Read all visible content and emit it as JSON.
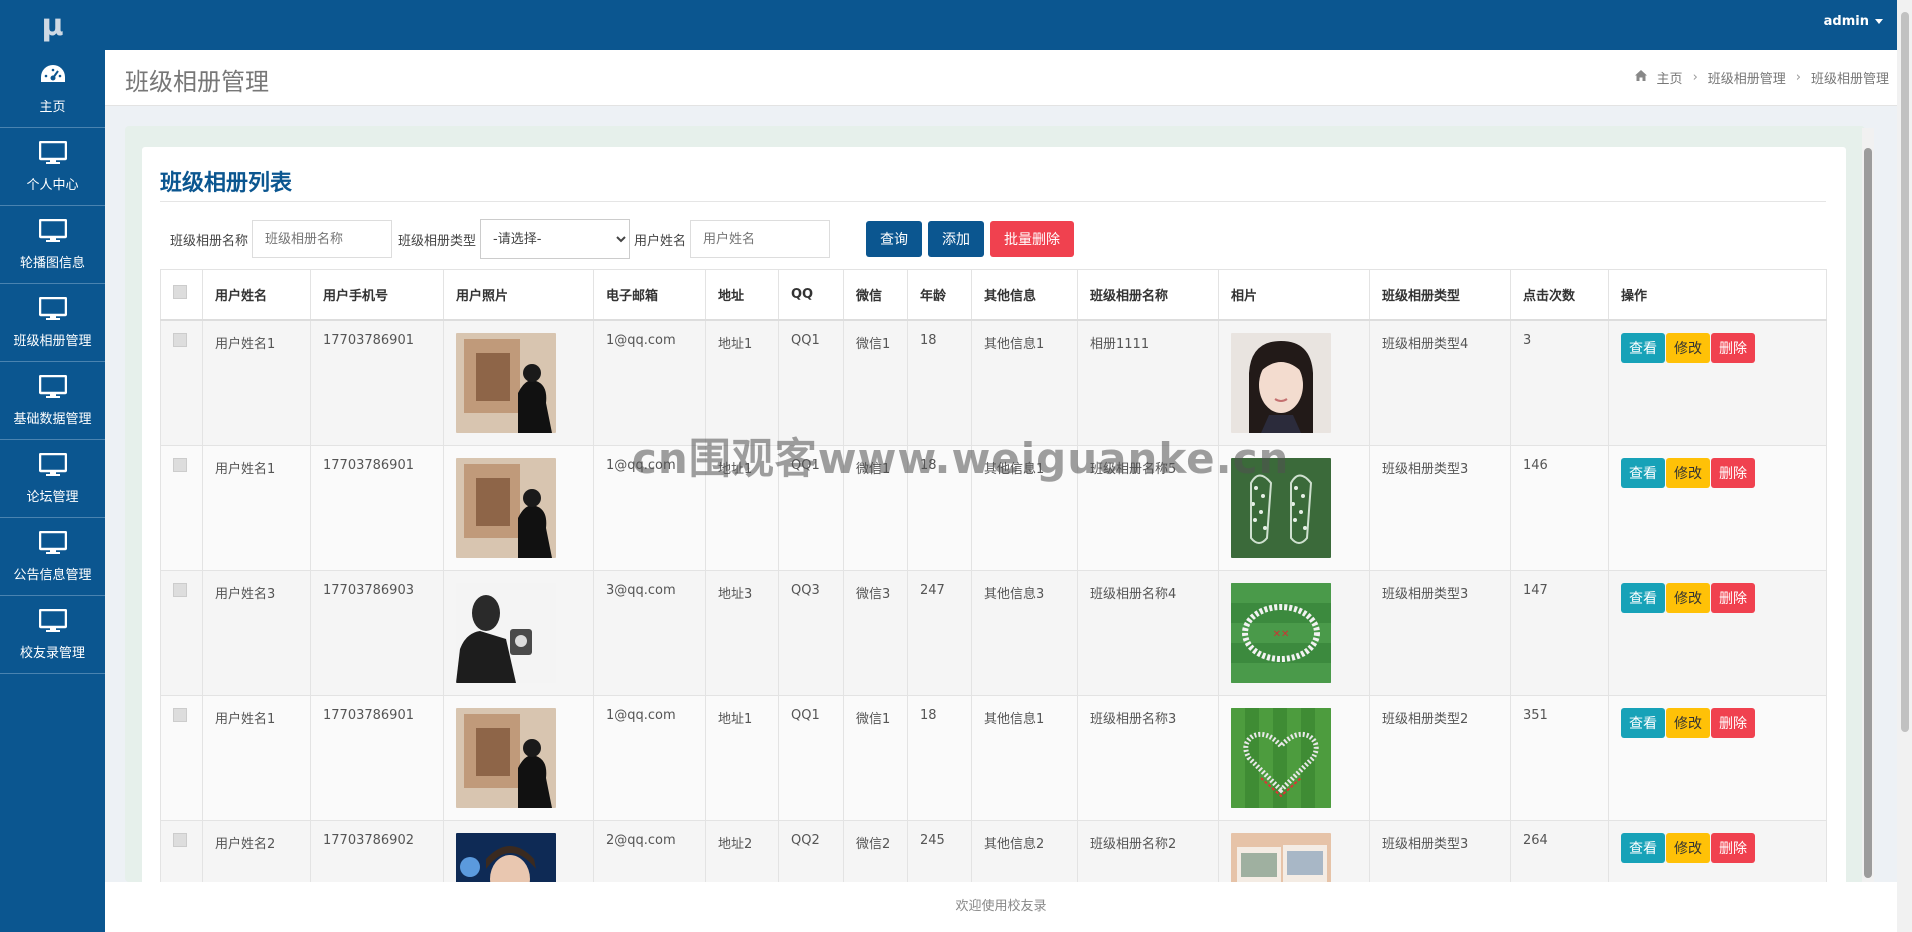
{
  "app": {
    "logo": "μ"
  },
  "sidebar": {
    "items": [
      {
        "label": "主页",
        "icon": "dashboard-icon"
      },
      {
        "label": "个人中心",
        "icon": "monitor-icon"
      },
      {
        "label": "轮播图信息",
        "icon": "monitor-icon"
      },
      {
        "label": "班级相册管理",
        "icon": "monitor-icon"
      },
      {
        "label": "基础数据管理",
        "icon": "monitor-icon"
      },
      {
        "label": "论坛管理",
        "icon": "monitor-icon"
      },
      {
        "label": "公告信息管理",
        "icon": "monitor-icon"
      },
      {
        "label": "校友录管理",
        "icon": "monitor-icon"
      }
    ]
  },
  "topbar": {
    "user": "admin"
  },
  "header": {
    "title": "班级相册管理",
    "breadcrumb": [
      "主页",
      "班级相册管理",
      "班级相册管理"
    ]
  },
  "card": {
    "title": "班级相册列表"
  },
  "search": {
    "name_label": "班级相册名称",
    "name_placeholder": "班级相册名称",
    "type_label": "班级相册类型",
    "type_selected": "-请选择-",
    "user_label": "用户姓名",
    "user_placeholder": "用户姓名",
    "query_btn": "查询",
    "add_btn": "添加",
    "batch_delete_btn": "批量删除"
  },
  "table": {
    "headers": [
      "用户姓名",
      "用户手机号",
      "用户照片",
      "电子邮箱",
      "地址",
      "QQ",
      "微信",
      "年龄",
      "其他信息",
      "班级相册名称",
      "相片",
      "班级相册类型",
      "点击次数",
      "操作"
    ],
    "ops": {
      "view": "查看",
      "edit": "修改",
      "delete": "删除"
    },
    "rows": [
      {
        "name": "用户姓名1",
        "phone": "17703786901",
        "email": "1@qq.com",
        "address": "地址1",
        "qq": "QQ1",
        "wechat": "微信1",
        "age": "18",
        "other": "其他信息1",
        "album": "相册1111",
        "type": "班级相册类型4",
        "clicks": "3"
      },
      {
        "name": "用户姓名1",
        "phone": "17703786901",
        "email": "1@qq.com",
        "address": "地址1",
        "qq": "QQ1",
        "wechat": "微信1",
        "age": "18",
        "other": "其他信息1",
        "album": "班级相册名称5",
        "type": "班级相册类型3",
        "clicks": "146"
      },
      {
        "name": "用户姓名3",
        "phone": "17703786903",
        "email": "3@qq.com",
        "address": "地址3",
        "qq": "QQ3",
        "wechat": "微信3",
        "age": "247",
        "other": "其他信息3",
        "album": "班级相册名称4",
        "type": "班级相册类型3",
        "clicks": "147"
      },
      {
        "name": "用户姓名1",
        "phone": "17703786901",
        "email": "1@qq.com",
        "address": "地址1",
        "qq": "QQ1",
        "wechat": "微信1",
        "age": "18",
        "other": "其他信息1",
        "album": "班级相册名称3",
        "type": "班级相册类型2",
        "clicks": "351"
      },
      {
        "name": "用户姓名2",
        "phone": "17703786902",
        "email": "2@qq.com",
        "address": "地址2",
        "qq": "QQ2",
        "wechat": "微信2",
        "age": "245",
        "other": "其他信息2",
        "album": "班级相册名称2",
        "type": "班级相册类型3",
        "clicks": "264"
      }
    ]
  },
  "watermark": "cn围观客www.weiguanke.cn",
  "footer": {
    "text": "欢迎使用校友录"
  }
}
